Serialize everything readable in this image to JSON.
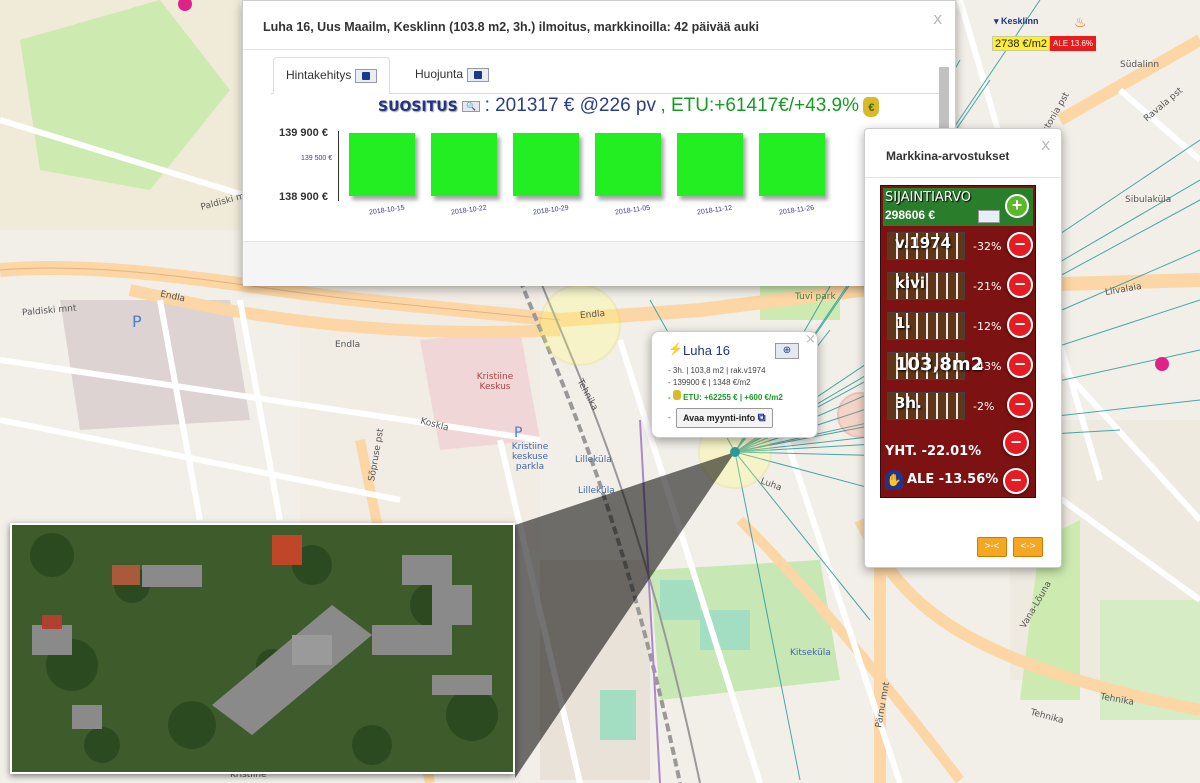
{
  "listing_panel": {
    "title": "Luha 16, Uus Maailm, Kesklinn (103.8 m2, 3h.) ilmoitus, markkinoilla: 42 päivää auki",
    "tabs": [
      {
        "label": "Hintakehitys"
      },
      {
        "label": "Huojunta"
      }
    ],
    "recommendation": {
      "label": "SUOSITUS",
      "price_text": ": 201317 € @226 pv",
      "benefit_text": ", ETU:+61417€/+43.9%"
    }
  },
  "chart_data": {
    "type": "bar",
    "categories": [
      "2018-10-15",
      "2018-10-22",
      "2018-10-29",
      "2018-11-05",
      "2018-11-12",
      "2018-11-26"
    ],
    "values": [
      139900,
      139900,
      139900,
      139900,
      139900,
      139900
    ],
    "ylim": [
      138900,
      139900
    ],
    "ytick_labels": [
      "139 900 €",
      "139 500 €",
      "138 900 €"
    ],
    "bar_color": "#22ee22"
  },
  "top_badge": {
    "district": "Kesklinn",
    "price": "2738 €/m2",
    "discount": "ALE 13.6%"
  },
  "popup": {
    "title": "Luha 16",
    "line1": "- 3h. | 103,8 m2 | rak.v1974",
    "line2": "- 139900 € | 1348 €/m2",
    "benefit": "ETU: +62255 € | +600 €/m2",
    "open_button": "Avaa myynti-info"
  },
  "market_panel": {
    "title": "Markkina-arvostukset",
    "location_label": "SIJAINTIARVO",
    "location_value": "298606 €",
    "rows": [
      {
        "label": "v.1974",
        "pct": "-32%"
      },
      {
        "label": "kivi",
        "pct": "-21%"
      },
      {
        "label": "1.",
        "pct": "-12%"
      },
      {
        "label": "103,8m2",
        "pct": "-43%"
      },
      {
        "label": "3h.",
        "pct": "-2%"
      }
    ],
    "total": "YHT. -22.01%",
    "discount": "ALE -13.56%",
    "buttons": [
      {
        "label": ">-<"
      },
      {
        "label": "<->"
      }
    ]
  },
  "map_labels": {
    "paldiski": "Paldiski mnt",
    "paldiski2": "Paldiski mnt",
    "endla": "Endla",
    "endla2": "Endla",
    "endla3": "Endla",
    "kristiine": "Kristiine Keskus",
    "parkla": "Kristiine keskuse parkla",
    "lillekyla": "Lilleküla",
    "lillekyla2": "Lilleküla",
    "tehnika": "Tehnika",
    "tehnika2": "Tehnika",
    "tehnika3": "Tehnika",
    "liivalaia": "Liivalaia",
    "sibulakula": "Sibulaküla",
    "sudalinn": "Südalinn",
    "kitsekula": "Kitseküla",
    "sopruse": "Sõpruse pst",
    "vana_louna": "Vana-Lõuna",
    "parnu": "Pärnu mnt",
    "kristiine_bottom": "Kristiine",
    "tuvi": "Tuvi park",
    "ravala": "Ravala pst",
    "estonia": "Estonia pst",
    "koskla": "Koskla",
    "luha": "Luha",
    "p1": "P",
    "p2": "P"
  }
}
